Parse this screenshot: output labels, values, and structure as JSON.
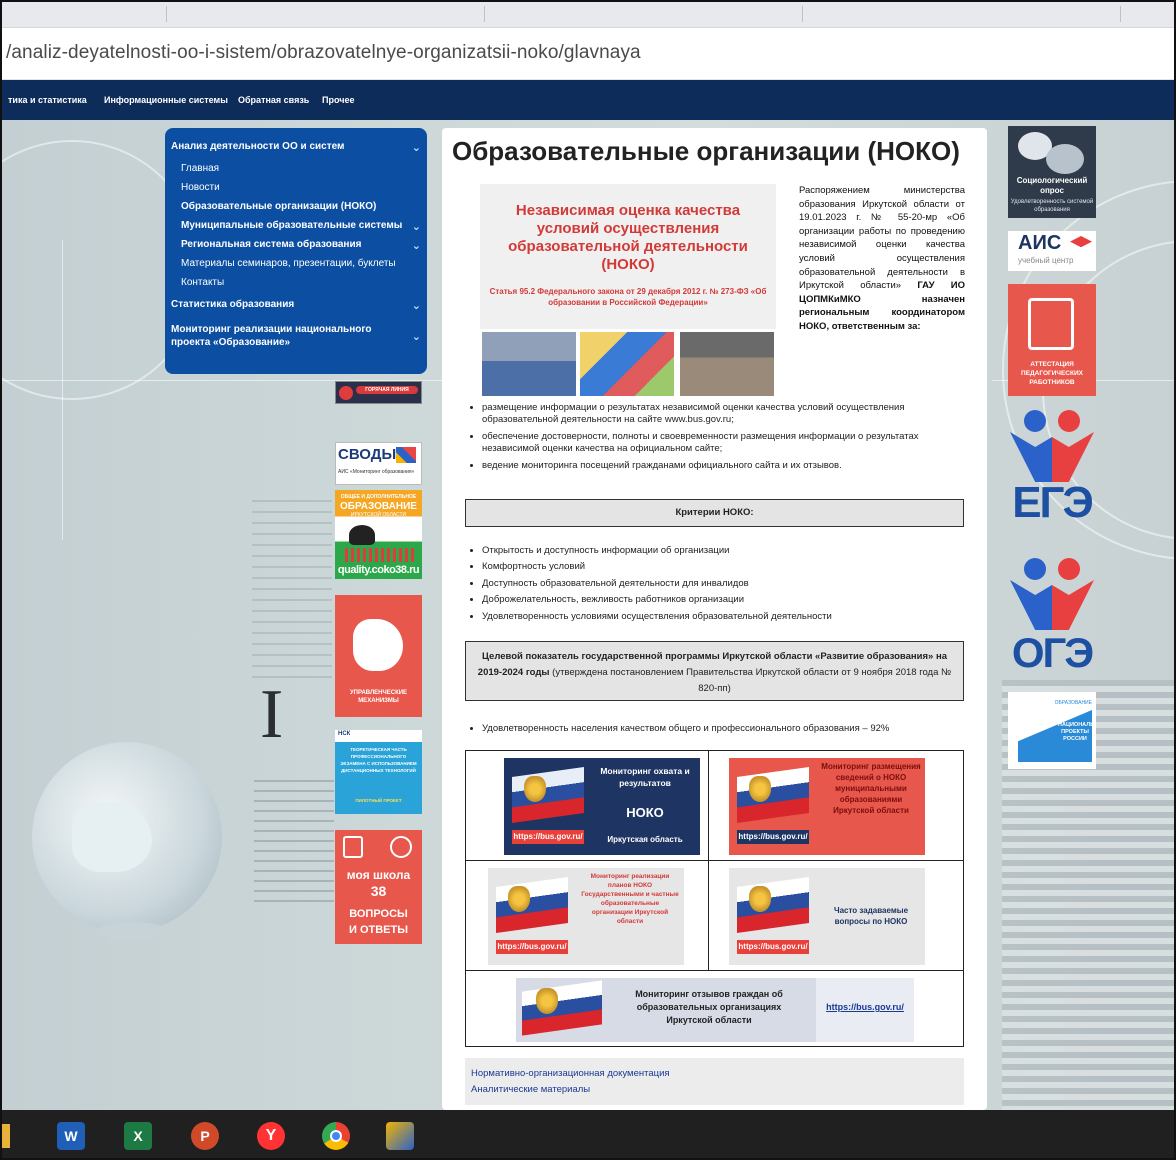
{
  "browser": {
    "url": "/analiz-deyatelnosti-oo-i-sistem/obrazovatelnye-organizatsii-noko/glavnaya"
  },
  "topnav": [
    "тика и статистика",
    "Информационные системы",
    "Обратная связь",
    "Прочее"
  ],
  "sidebar": {
    "section1": "Анализ деятельности ОО и систем",
    "items": [
      {
        "label": "Главная",
        "bold": false,
        "chevron": false
      },
      {
        "label": "Новости",
        "bold": false,
        "chevron": false
      },
      {
        "label": "Образовательные организации (НОКО)",
        "bold": true,
        "chevron": false
      },
      {
        "label": "Муниципальные образовательные системы",
        "bold": true,
        "chevron": true
      },
      {
        "label": "Региональная система образования",
        "bold": true,
        "chevron": true
      },
      {
        "label": "Материалы семинаров, презентации, буклеты",
        "bold": false,
        "chevron": false
      },
      {
        "label": "Контакты",
        "bold": false,
        "chevron": false
      }
    ],
    "section2": "Статистика образования",
    "section3": "Мониторинг реализации национального проекта «Образование»"
  },
  "left_banners": {
    "hotline": "ГОРЯЧАЯ ЛИНИЯ",
    "svody": "СВОДЫ",
    "svody_sub": "АИС «Мониторинг образования»",
    "quality_top": "ОБЩЕЕ И ДОПОЛНИТЕЛЬНОЕ",
    "quality_main": "ОБРАЗОВАНИЕ",
    "quality_sub": "ИРКУТСКОЙ ОБЛАСТИ",
    "quality_url": "quality.coko38.ru",
    "upr": "УПРАВЛЕНЧЕСКИЕ МЕХАНИЗМЫ",
    "nsk_logo": "НСК",
    "nsk_text": "ТЕОРЕТИЧЕСКАЯ ЧАСТЬ ПРОФЕССИОНАЛЬНОГО ЭКЗАМЕНА С ИСПОЛЬЗОВАНИЕМ ДИСТАНЦИОННЫХ ТЕХНОЛОГИЙ",
    "nsk_sub": "ПИЛОТНЫЙ ПРОЕКТ",
    "school_1": "моя школа",
    "school_2": "38",
    "school_3": "ВОПРОСЫ",
    "school_4": "И ОТВЕТЫ"
  },
  "main": {
    "title": "Образовательные организации (НОКО)",
    "banner_main": "Независимая оценка качества условий осуществления образовательной деятельности (НОКО)",
    "banner_sub": "Статья 95.2 Федерального закона от 29 декабря 2012 г. № 273-ФЗ «Об образовании в Российской Федерации»",
    "intro_a": "Распоряжением министерства образования Иркутской области от 19.01.2023 г. № 55-20-мр «Об организации работы по проведению независимой оценки качества условий осуществления образовательной деятельности в Иркутской области»",
    "intro_b": "ГАУ ИО ЦОПМКиМКО назначен региональным координатором НОКО, ответственным за:",
    "duties": [
      "размещение информации о результатах независимой оценки качества условий осуществления образовательной деятельности на сайте www.bus.gov.ru;",
      "обеспечение достоверности, полноты и своевременности размещения информации о результатах независимой оценки качества на официальном сайте;",
      "ведение мониторинга посещений гражданами официального сайта и их отзывов."
    ],
    "criteria_title": "Критерии НОКО:",
    "criteria": [
      "Открытость и доступность информации об организации",
      "Комфортность условий",
      "Доступность образовательной деятельности для инвалидов",
      "Доброжелательность, вежливость работников организации",
      "Удовлетворенность условиями осуществления образовательной деятельности"
    ],
    "target_bold": "Целевой показатель государственной программы Иркутской области «Развитие образования» на 2019-2024 годы",
    "target_rest": "(утверждена постановлением Правительства Иркутской области от 9 ноября 2018 года № 820-пп)",
    "target_items": [
      "Удовлетворенность населения качеством общего и профессионального образования – 92%"
    ],
    "monitors": {
      "m1_title": "Мониторинг охвата и результатов",
      "m1_noko": "НОКО",
      "m1_region": "Иркутская область",
      "m1_url": "https://bus.gov.ru/",
      "m2_title": "Мониторинг размещения сведений о НОКО муниципальными образованиями Иркутской области",
      "m2_url": "https://bus.gov.ru/",
      "m3_title": "Мониторинг реализации планов НОКО Государственными и частные образовательные организации Иркутской области",
      "m3_url": "https://bus.gov.ru/",
      "m4_title": "Часто задаваемые вопросы по НОКО",
      "m4_url": "https://bus.gov.ru/",
      "m5_title": "Мониторинг отзывов граждан об образовательных организациях Иркутской области",
      "m5_url": "https://bus.gov.ru/"
    },
    "links": [
      "Нормативно-организационная документация",
      "Аналитические материалы"
    ]
  },
  "right_banners": {
    "socio_title": "Социологический опрос",
    "socio_sub": "Удовлетворенность системой образования",
    "ais": "АИС",
    "ais_sub": "учебный центр",
    "attest": "АТТЕСТАЦИЯ ПЕДАГОГИЧЕСКИХ РАБОТНИКОВ",
    "ege": "ЕГЭ",
    "oge": "ОГЭ",
    "natproj_1": "ОБРАЗОВАНИЕ",
    "natproj_2": "НАЦИОНАЛЬНЫЕ ПРОЕКТЫ РОССИИ"
  },
  "colors": {
    "nav": "#0d2c5a",
    "sidebar": "#0b4ea2",
    "accent_red": "#e8574b",
    "link": "#1a3a94"
  },
  "taskbar_icons": [
    "word-icon",
    "excel-icon",
    "powerpoint-icon",
    "yandex-icon",
    "chrome-icon",
    "app-icon"
  ]
}
